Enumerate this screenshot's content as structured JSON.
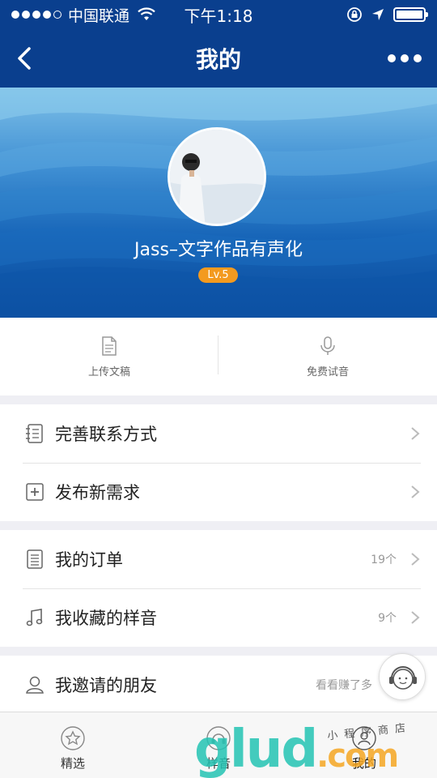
{
  "status_bar": {
    "carrier": "中国联通",
    "time": "下午1:18",
    "icons": [
      "signal-dots",
      "wifi-icon",
      "lock-rotation-icon",
      "location-arrow-icon",
      "battery-icon"
    ]
  },
  "navbar": {
    "title": "我的",
    "back_icon": "chevron-left-icon",
    "more_icon": "more-dots-icon"
  },
  "profile": {
    "username": "Jass–文字作品有声化",
    "level": "Lv.5"
  },
  "actions": [
    {
      "label": "上传文稿",
      "icon": "document-icon"
    },
    {
      "label": "免费试音",
      "icon": "microphone-icon"
    }
  ],
  "menu_groups": [
    [
      {
        "label": "完善联系方式",
        "icon": "contacts-book-icon"
      },
      {
        "label": "发布新需求",
        "icon": "plus-square-icon"
      }
    ],
    [
      {
        "label": "我的订单",
        "icon": "order-list-icon",
        "count": "19个"
      },
      {
        "label": "我收藏的样音",
        "icon": "music-note-icon",
        "count": "9个"
      }
    ],
    [
      {
        "label": "我邀请的朋友",
        "icon": "person-icon",
        "count": "看看赚了多"
      }
    ]
  ],
  "tabbar": [
    {
      "label": "精选",
      "icon": "star-icon"
    },
    {
      "label": "样音",
      "icon": "headphones-icon"
    },
    {
      "label": "我的",
      "icon": "person-icon"
    }
  ],
  "watermark": {
    "brand": "glud",
    "suffix": ".com",
    "sub": "小程序商店"
  },
  "colors": {
    "nav": "#0a3f8e",
    "level_badge": "#f39a1f",
    "watermark_green": "#24c4b4",
    "watermark_orange": "#f5a623"
  }
}
